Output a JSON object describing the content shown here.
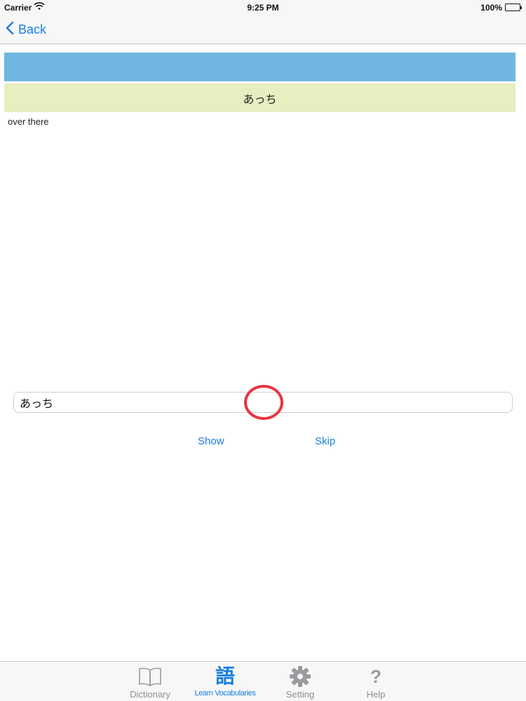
{
  "status_bar": {
    "carrier": "Carrier",
    "time": "9:25 PM",
    "battery": "100%"
  },
  "nav": {
    "back_label": "Back"
  },
  "quiz": {
    "word": "あっち",
    "meaning": "over there"
  },
  "answer": {
    "value": "あっち"
  },
  "actions": {
    "show_label": "Show",
    "skip_label": "Skip"
  },
  "tabs": [
    {
      "label": "Dictionary",
      "icon": "book-icon"
    },
    {
      "label": "Learn Vocabularies",
      "icon": "kanji-icon",
      "glyph": "語",
      "active": true
    },
    {
      "label": "Setting",
      "icon": "gear-icon"
    },
    {
      "label": "Help",
      "icon": "question-icon",
      "glyph": "?"
    }
  ],
  "colors": {
    "accent": "#1a7fe0",
    "header_blue": "#6fb6e0",
    "word_bar": "#e6efc0",
    "tap_indicator": "#e8363f"
  }
}
